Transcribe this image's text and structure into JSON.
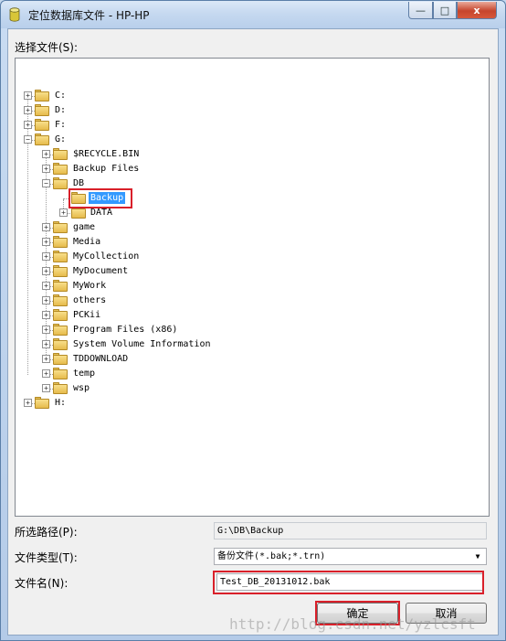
{
  "window": {
    "title": "定位数据库文件 - HP-HP",
    "minimize": "—",
    "maximize": "□",
    "close": "x"
  },
  "select_file_label": "选择文件(S):",
  "tree": {
    "nodes": [
      {
        "label": "C:",
        "expander": "+"
      },
      {
        "label": "D:",
        "expander": "+"
      },
      {
        "label": "F:",
        "expander": "+"
      },
      {
        "label": "G:",
        "expander": "−"
      },
      {
        "label": "$RECYCLE.BIN",
        "expander": "+"
      },
      {
        "label": "Backup Files",
        "expander": "+"
      },
      {
        "label": "DB",
        "expander": "−"
      },
      {
        "label": "Backup",
        "expander": ""
      },
      {
        "label": "DATA",
        "expander": "+"
      },
      {
        "label": "game",
        "expander": "+"
      },
      {
        "label": "Media",
        "expander": "+"
      },
      {
        "label": "MyCollection",
        "expander": "+"
      },
      {
        "label": "MyDocument",
        "expander": "+"
      },
      {
        "label": "MyWork",
        "expander": "+"
      },
      {
        "label": "others",
        "expander": "+"
      },
      {
        "label": "PCKii",
        "expander": "+"
      },
      {
        "label": "Program Files (x86)",
        "expander": "+"
      },
      {
        "label": "System Volume Information",
        "expander": "+"
      },
      {
        "label": "TDDOWNLOAD",
        "expander": "+"
      },
      {
        "label": "temp",
        "expander": "+"
      },
      {
        "label": "wsp",
        "expander": "+"
      },
      {
        "label": "H:",
        "expander": "+"
      }
    ]
  },
  "fields": {
    "path_label": "所选路径(P):",
    "path_value": "G:\\DB\\Backup",
    "type_label": "文件类型(T):",
    "type_value": "备份文件(*.bak;*.trn)",
    "name_label": "文件名(N):",
    "name_value": "Test_DB_20131012.bak"
  },
  "buttons": {
    "ok": "确定",
    "cancel": "取消"
  },
  "watermark": "http://blog.csdn.net/yzlcsft",
  "colors": {
    "selection": "#3399ff",
    "highlight_box": "#d9202a"
  }
}
